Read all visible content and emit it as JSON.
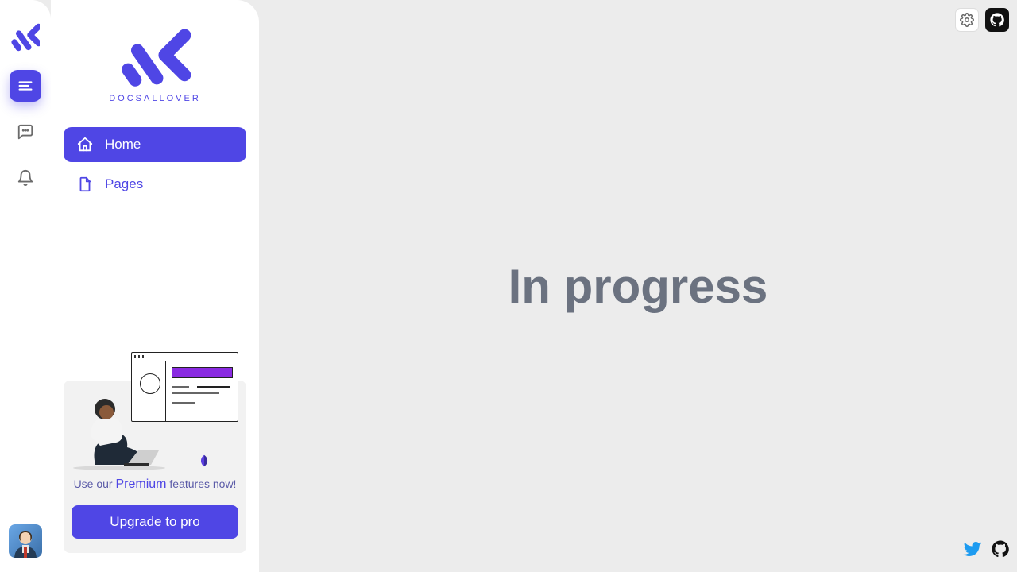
{
  "brand": {
    "name": "DOCSALLOVER"
  },
  "nav": {
    "items": [
      {
        "label": "Home",
        "active": true
      },
      {
        "label": "Pages",
        "active": false
      }
    ]
  },
  "promo": {
    "pre": "Use our ",
    "mid": "Premium",
    "post": " features now!",
    "cta": "Upgrade to pro"
  },
  "main": {
    "heading": "In progress"
  },
  "colors": {
    "accent": "#4f46e5"
  }
}
